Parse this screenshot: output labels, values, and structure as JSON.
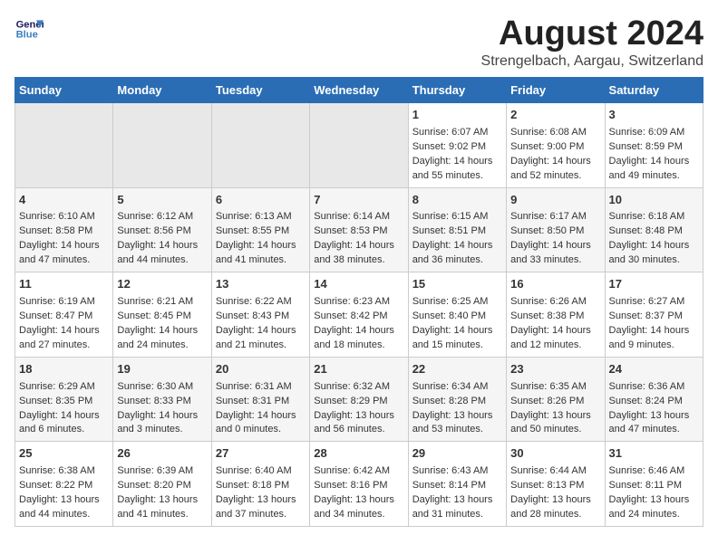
{
  "header": {
    "logo_line1": "General",
    "logo_line2": "Blue",
    "month": "August 2024",
    "location": "Strengelbach, Aargau, Switzerland"
  },
  "weekdays": [
    "Sunday",
    "Monday",
    "Tuesday",
    "Wednesday",
    "Thursday",
    "Friday",
    "Saturday"
  ],
  "weeks": [
    [
      {
        "day": "",
        "content": ""
      },
      {
        "day": "",
        "content": ""
      },
      {
        "day": "",
        "content": ""
      },
      {
        "day": "",
        "content": ""
      },
      {
        "day": "1",
        "content": "Sunrise: 6:07 AM\nSunset: 9:02 PM\nDaylight: 14 hours\nand 55 minutes."
      },
      {
        "day": "2",
        "content": "Sunrise: 6:08 AM\nSunset: 9:00 PM\nDaylight: 14 hours\nand 52 minutes."
      },
      {
        "day": "3",
        "content": "Sunrise: 6:09 AM\nSunset: 8:59 PM\nDaylight: 14 hours\nand 49 minutes."
      }
    ],
    [
      {
        "day": "4",
        "content": "Sunrise: 6:10 AM\nSunset: 8:58 PM\nDaylight: 14 hours\nand 47 minutes."
      },
      {
        "day": "5",
        "content": "Sunrise: 6:12 AM\nSunset: 8:56 PM\nDaylight: 14 hours\nand 44 minutes."
      },
      {
        "day": "6",
        "content": "Sunrise: 6:13 AM\nSunset: 8:55 PM\nDaylight: 14 hours\nand 41 minutes."
      },
      {
        "day": "7",
        "content": "Sunrise: 6:14 AM\nSunset: 8:53 PM\nDaylight: 14 hours\nand 38 minutes."
      },
      {
        "day": "8",
        "content": "Sunrise: 6:15 AM\nSunset: 8:51 PM\nDaylight: 14 hours\nand 36 minutes."
      },
      {
        "day": "9",
        "content": "Sunrise: 6:17 AM\nSunset: 8:50 PM\nDaylight: 14 hours\nand 33 minutes."
      },
      {
        "day": "10",
        "content": "Sunrise: 6:18 AM\nSunset: 8:48 PM\nDaylight: 14 hours\nand 30 minutes."
      }
    ],
    [
      {
        "day": "11",
        "content": "Sunrise: 6:19 AM\nSunset: 8:47 PM\nDaylight: 14 hours\nand 27 minutes."
      },
      {
        "day": "12",
        "content": "Sunrise: 6:21 AM\nSunset: 8:45 PM\nDaylight: 14 hours\nand 24 minutes."
      },
      {
        "day": "13",
        "content": "Sunrise: 6:22 AM\nSunset: 8:43 PM\nDaylight: 14 hours\nand 21 minutes."
      },
      {
        "day": "14",
        "content": "Sunrise: 6:23 AM\nSunset: 8:42 PM\nDaylight: 14 hours\nand 18 minutes."
      },
      {
        "day": "15",
        "content": "Sunrise: 6:25 AM\nSunset: 8:40 PM\nDaylight: 14 hours\nand 15 minutes."
      },
      {
        "day": "16",
        "content": "Sunrise: 6:26 AM\nSunset: 8:38 PM\nDaylight: 14 hours\nand 12 minutes."
      },
      {
        "day": "17",
        "content": "Sunrise: 6:27 AM\nSunset: 8:37 PM\nDaylight: 14 hours\nand 9 minutes."
      }
    ],
    [
      {
        "day": "18",
        "content": "Sunrise: 6:29 AM\nSunset: 8:35 PM\nDaylight: 14 hours\nand 6 minutes."
      },
      {
        "day": "19",
        "content": "Sunrise: 6:30 AM\nSunset: 8:33 PM\nDaylight: 14 hours\nand 3 minutes."
      },
      {
        "day": "20",
        "content": "Sunrise: 6:31 AM\nSunset: 8:31 PM\nDaylight: 14 hours\nand 0 minutes."
      },
      {
        "day": "21",
        "content": "Sunrise: 6:32 AM\nSunset: 8:29 PM\nDaylight: 13 hours\nand 56 minutes."
      },
      {
        "day": "22",
        "content": "Sunrise: 6:34 AM\nSunset: 8:28 PM\nDaylight: 13 hours\nand 53 minutes."
      },
      {
        "day": "23",
        "content": "Sunrise: 6:35 AM\nSunset: 8:26 PM\nDaylight: 13 hours\nand 50 minutes."
      },
      {
        "day": "24",
        "content": "Sunrise: 6:36 AM\nSunset: 8:24 PM\nDaylight: 13 hours\nand 47 minutes."
      }
    ],
    [
      {
        "day": "25",
        "content": "Sunrise: 6:38 AM\nSunset: 8:22 PM\nDaylight: 13 hours\nand 44 minutes."
      },
      {
        "day": "26",
        "content": "Sunrise: 6:39 AM\nSunset: 8:20 PM\nDaylight: 13 hours\nand 41 minutes."
      },
      {
        "day": "27",
        "content": "Sunrise: 6:40 AM\nSunset: 8:18 PM\nDaylight: 13 hours\nand 37 minutes."
      },
      {
        "day": "28",
        "content": "Sunrise: 6:42 AM\nSunset: 8:16 PM\nDaylight: 13 hours\nand 34 minutes."
      },
      {
        "day": "29",
        "content": "Sunrise: 6:43 AM\nSunset: 8:14 PM\nDaylight: 13 hours\nand 31 minutes."
      },
      {
        "day": "30",
        "content": "Sunrise: 6:44 AM\nSunset: 8:13 PM\nDaylight: 13 hours\nand 28 minutes."
      },
      {
        "day": "31",
        "content": "Sunrise: 6:46 AM\nSunset: 8:11 PM\nDaylight: 13 hours\nand 24 minutes."
      }
    ]
  ]
}
